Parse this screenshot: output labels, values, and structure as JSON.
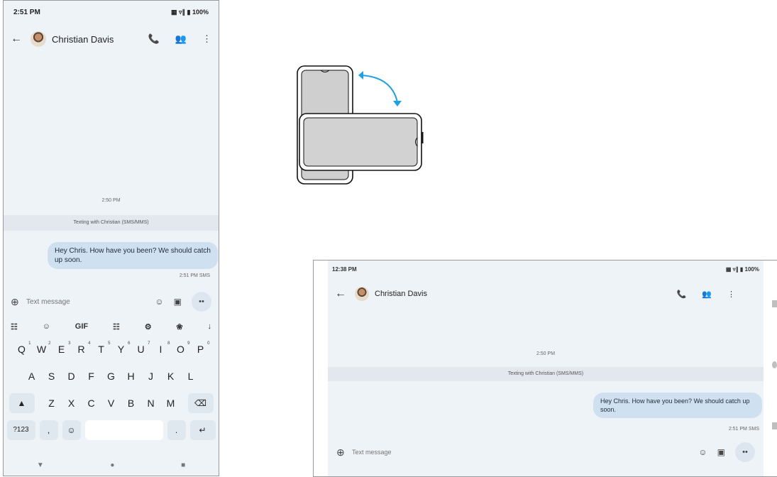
{
  "portrait": {
    "status": {
      "time": "2:51 PM",
      "icons": "▦ ▿∥ ▮ 100%"
    },
    "appbar": {
      "contact_name": "Christian Davis"
    },
    "conversation": {
      "timestamp": "2:50 PM",
      "texting_label": "Texting with Christian (SMS/MMS)",
      "message": "Hey Chris. How have you been? We should catch up soon.",
      "message_meta": "2:51 PM SMS"
    },
    "compose": {
      "placeholder": "Text message"
    },
    "keyboard": {
      "toolbar": [
        "☷",
        "☺",
        "GIF",
        "☷",
        "⚙",
        "❀",
        "↓"
      ],
      "row1": [
        "Q",
        "W",
        "E",
        "R",
        "T",
        "Y",
        "U",
        "I",
        "O",
        "P"
      ],
      "row1_digits": [
        "1",
        "2",
        "3",
        "4",
        "5",
        "6",
        "7",
        "8",
        "9",
        "0"
      ],
      "row2": [
        "A",
        "S",
        "D",
        "F",
        "G",
        "H",
        "J",
        "K",
        "L"
      ],
      "row3": [
        "Z",
        "X",
        "C",
        "V",
        "B",
        "N",
        "M"
      ],
      "symbols_key": "?123",
      "comma_key": ",",
      "period_key": "."
    }
  },
  "landscape": {
    "status": {
      "time": "12:38 PM",
      "icons": "▦ ▿∥ ▮ 100%"
    },
    "appbar": {
      "contact_name": "Christian Davis"
    },
    "conversation": {
      "timestamp": "2:50 PM",
      "texting_label": "Texting with Christian (SMS/MMS)",
      "message": "Hey Chris. How have you been? We should catch up soon.",
      "message_meta": "2:51 PM SMS"
    },
    "compose": {
      "placeholder": "Text message"
    }
  },
  "colors": {
    "accent_arrow": "#1ba1e2",
    "bubble": "#cfe0f1",
    "screen_bg": "#eef3f8"
  }
}
